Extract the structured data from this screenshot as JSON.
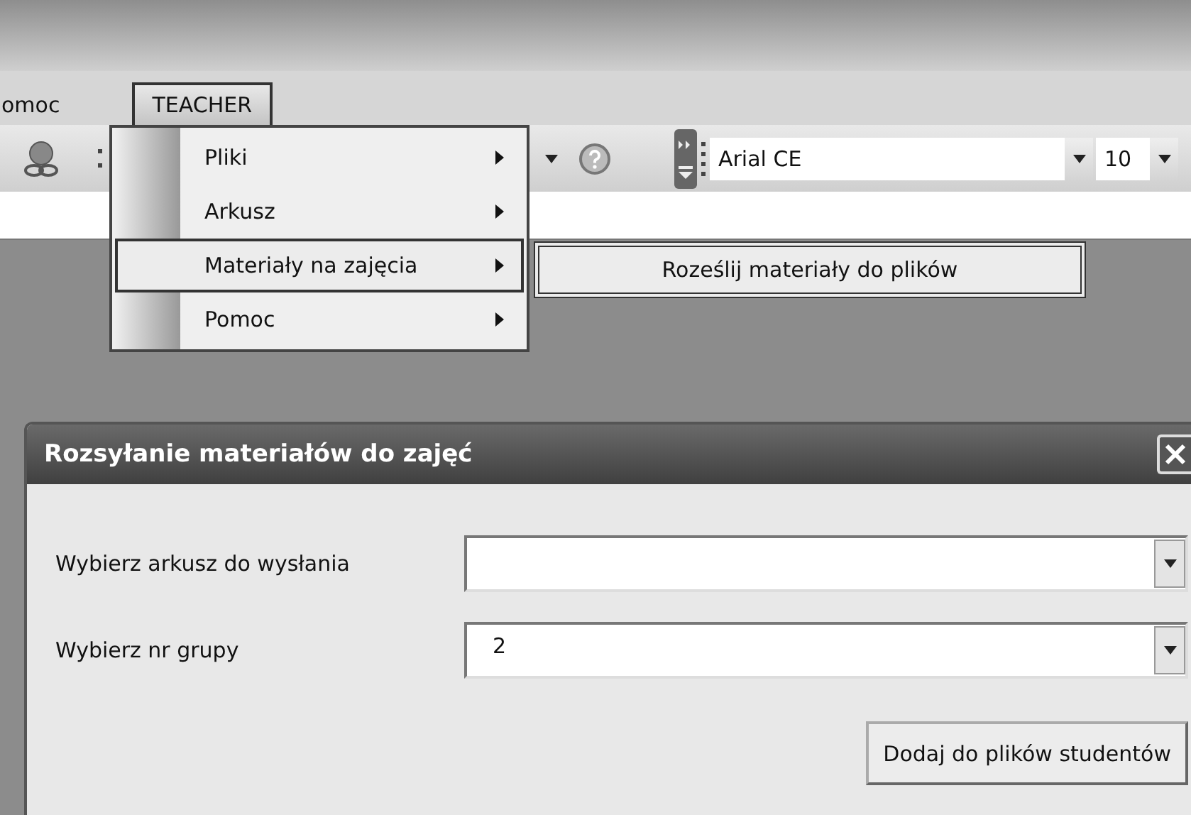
{
  "menu_bar": {
    "items": [
      {
        "label": "omoc",
        "selected": false
      },
      {
        "label": "TEACHER",
        "selected": true
      }
    ]
  },
  "toolbar": {
    "font": "Arial CE",
    "font_size": "10"
  },
  "dropdown_menu": {
    "items": [
      {
        "label": "Pliki",
        "selected": false
      },
      {
        "label": "Arkusz",
        "selected": false
      },
      {
        "label": "Materiały na zajęcia",
        "selected": true
      },
      {
        "label": "Pomoc",
        "selected": false
      }
    ]
  },
  "submenu": {
    "items": [
      {
        "label": "Roześlij materiały do plików",
        "selected": false
      }
    ]
  },
  "dialog": {
    "title": "Rozsyłanie materiałów do zajęć",
    "fields": [
      {
        "label": "Wybierz arkusz do wysłania"
      },
      {
        "label": "Wybierz nr grupy",
        "value": "2"
      }
    ],
    "button": "Dodaj do plików studentów"
  }
}
